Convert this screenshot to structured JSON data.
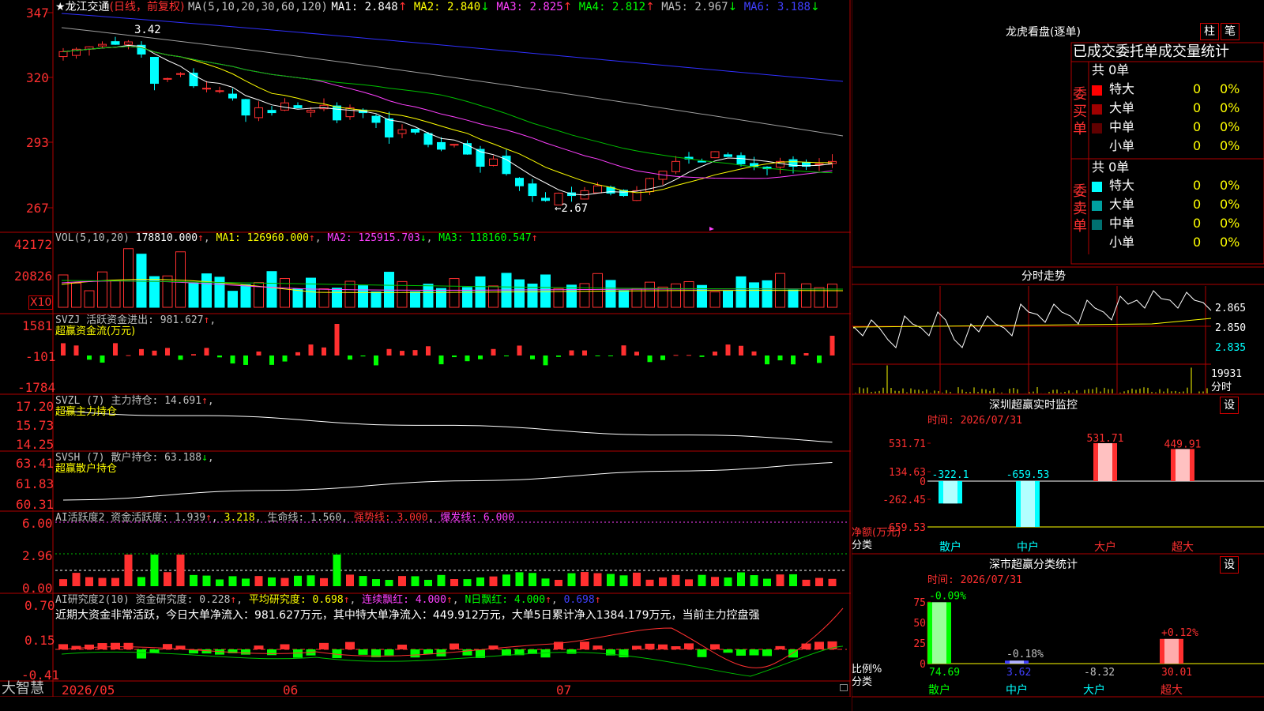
{
  "stock": {
    "title_star": "★龙江交通",
    "period": "(日线，前复权)"
  },
  "price_panel": {
    "y_labels": [
      "347",
      "320",
      "293",
      "267"
    ],
    "ma_header": "MA(5,10,20,30,60,120)",
    "ma": [
      {
        "label": "MA1: 2.848",
        "arrow": "↑",
        "color": "#ffffff"
      },
      {
        "label": "MA2: 2.840",
        "arrow": "↓",
        "color": "#ffff00"
      },
      {
        "label": "MA3: 2.825",
        "arrow": "↑",
        "color": "#ff40ff"
      },
      {
        "label": "MA4: 2.812",
        "arrow": "↑",
        "color": "#00ff00"
      },
      {
        "label": "MA5: 2.967",
        "arrow": "↓",
        "color": "#c0c0c0"
      },
      {
        "label": "MA6: 3.188",
        "arrow": "↓",
        "color": "#4040ff"
      }
    ],
    "high_mark": "3.42",
    "low_mark": "←2.67"
  },
  "vol_panel": {
    "header": "VOL(5,10,20)",
    "value": "178810.000",
    "ma1": "MA1: 126960.000",
    "ma2": "MA2: 125915.703",
    "ma3": "MA3: 118160.547",
    "y_labels": [
      "42172",
      "20826"
    ],
    "unit_badge": "X10"
  },
  "svzj_panel": {
    "header": "SVZJ  活跃资金进出: 981.627",
    "subtitle": "超赢资金流(万元)",
    "y_labels": [
      "1581",
      "-101",
      "-1784"
    ]
  },
  "svzl_panel": {
    "header": "SVZL (7) 主力持仓: 14.691",
    "subtitle": "超赢主力持仓",
    "y_labels": [
      "17.20",
      "15.73",
      "14.25"
    ]
  },
  "svsh_panel": {
    "header": "SVSH (7) 散户持仓: 63.188",
    "subtitle": "超赢散户持仓",
    "y_labels": [
      "63.41",
      "61.83",
      "60.31"
    ]
  },
  "ai_active_panel": {
    "header": "AI活跃度2 资金活跃度: 1.939",
    "v2": "3.218",
    "life": "生命线: 1.560",
    "strong": "强势线: 3.000",
    "burst": "爆发线: 6.000",
    "y_labels": [
      "6.00",
      "2.96",
      "0.00"
    ]
  },
  "ai_research_panel": {
    "header": "AI研究度2(10) 资金研究度: 0.228",
    "avg": "平均研究度: 0.698",
    "streak": "连续飘红: 4.000",
    "nday": "N日飘红: 4.000",
    "v5": "0.698",
    "comment": "近期大资金非常活跃，今日大单净流入：981.627万元，其中特大单净流入：449.912万元，大单5日累计净入1384.179万元，当前主力控盘强",
    "y_labels": [
      "0.70",
      "0.15",
      "-0.41"
    ]
  },
  "x_axis": {
    "logo": "大智慧",
    "labels": [
      "2026/05",
      "06",
      "07"
    ]
  },
  "right": {
    "dragon_title": "龙虎看盘(逐单)",
    "btn_column": "柱",
    "btn_detail": "笔",
    "table_title": "已成交委托单成交量统计",
    "buy_label": "委买单",
    "sell_label": "委卖单",
    "buy_total": "共 0单",
    "sell_total": "共 0单",
    "buy_rows": [
      {
        "name": "特大",
        "count": "0",
        "pct": "0%",
        "color": "#ff0000"
      },
      {
        "name": "大单",
        "count": "0",
        "pct": "0%",
        "color": "#a00000"
      },
      {
        "name": "中单",
        "count": "0",
        "pct": "0%",
        "color": "#600000"
      },
      {
        "name": "小单",
        "count": "0",
        "pct": "0%",
        "color": "#000000"
      }
    ],
    "sell_rows": [
      {
        "name": "特大",
        "count": "0",
        "pct": "0%",
        "color": "#00ffff"
      },
      {
        "name": "大单",
        "count": "0",
        "pct": "0%",
        "color": "#00a0a0"
      },
      {
        "name": "中单",
        "count": "0",
        "pct": "0%",
        "color": "#007070"
      },
      {
        "name": "小单",
        "count": "0",
        "pct": "0%",
        "color": "#000000"
      }
    ],
    "intraday_title": "分时走势",
    "intraday_y": [
      "2.865",
      "2.850",
      "2.835"
    ],
    "intraday_vol": "19931",
    "intraday_vol_unit": "分时",
    "sz_monitor_title": "深圳超赢实时监控",
    "sz_monitor_time": "时间: 2026/07/31",
    "monitor_set": "设",
    "monitor_y": [
      "531.71",
      "134.63",
      "0",
      "-262.45",
      "-659.53"
    ],
    "monitor_ylabel": "净额(万元)",
    "monitor_xlabel": "分类",
    "monitor_bars": [
      {
        "name": "散户",
        "value": -322.1,
        "label": "-322.1"
      },
      {
        "name": "中户",
        "value": -659.53,
        "label": "-659.53"
      },
      {
        "name": "大户",
        "value": 531.71,
        "label": "531.71"
      },
      {
        "name": "超大",
        "value": 449.91,
        "label": "449.91"
      }
    ],
    "sz_class_title": "深市超赢分类统计",
    "sz_class_time": "时间: 2026/07/31",
    "class_set": "设",
    "class_y": [
      "75",
      "50",
      "25",
      "0"
    ],
    "class_ylabel": "比例%",
    "class_xlabel": "分类",
    "class_bars": [
      {
        "name": "散户",
        "value": 74.69,
        "label": "74.69",
        "change": "-0.09%"
      },
      {
        "name": "中户",
        "value": 3.62,
        "label": "3.62",
        "change": "-0.18%"
      },
      {
        "name": "大户",
        "value": -8.32,
        "label": "-8.32",
        "change": ""
      },
      {
        "name": "超大",
        "value": 30.01,
        "label": "30.01",
        "change": "+0.12%"
      }
    ]
  },
  "chart_data": {
    "type": "candlestick",
    "title": "龙江交通 (日线，前复权)",
    "x_labels": [
      "2026/05",
      "06",
      "07"
    ],
    "ylim": [
      2.6,
      3.5
    ],
    "high": 3.42,
    "low": 2.67,
    "last_close": 2.86,
    "ma_last": {
      "MA1": 2.848,
      "MA2": 2.84,
      "MA3": 2.825,
      "MA4": 2.812,
      "MA5": 2.967,
      "MA6": 3.188
    },
    "volume_last": 178810.0,
    "volume_ylim": [
      0,
      421720
    ],
    "svzj_last": 981.627,
    "svzl_last": 14.691,
    "svsh_last": 63.188,
    "ai_active_last": 1.939,
    "ai_research_last": 0.228
  }
}
